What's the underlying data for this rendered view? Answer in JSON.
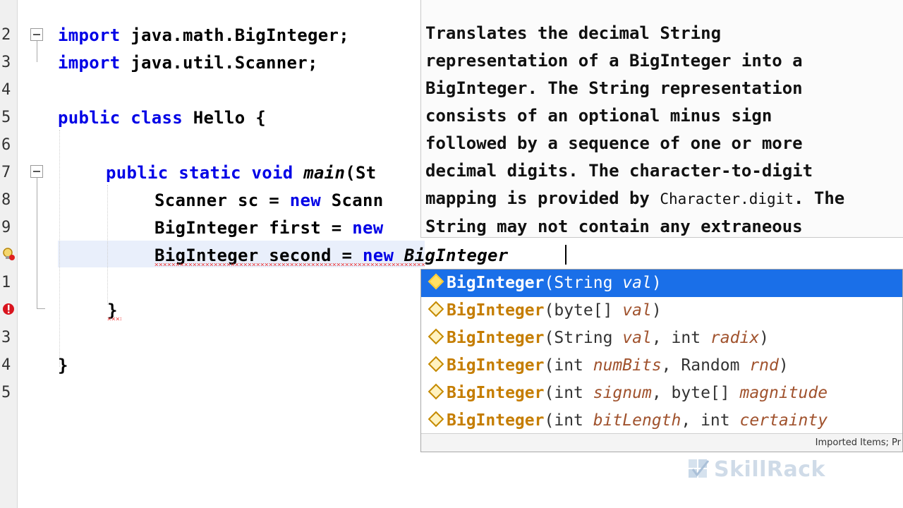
{
  "editor": {
    "line_numbers": [
      "2",
      "3",
      "4",
      "5",
      "6",
      "7",
      "8",
      "9",
      "",
      "1",
      "",
      "3",
      "4",
      "5"
    ],
    "lines": {
      "l2": {
        "kw": "import",
        "rest": " java.math.BigInteger;"
      },
      "l3": {
        "kw": "import",
        "rest": " java.util.Scanner;"
      },
      "l5": {
        "kw1": "public",
        "kw2": " class",
        "rest": " Hello {"
      },
      "l7": {
        "kw1": "public",
        "kw2": " static",
        "kw3": " void",
        "method": " main",
        "rest": "(St"
      },
      "l8": {
        "a": "Scanner sc = ",
        "kw": "new",
        "b": " Scann"
      },
      "l9": {
        "a": "BigInteger first = ",
        "kw": "new"
      },
      "l10": {
        "a": "BigInteger second = ",
        "kw": "new",
        "typed": " BigInteger"
      },
      "l12": {
        "text": "}"
      },
      "l14": {
        "text": "}"
      }
    }
  },
  "javadoc": {
    "line1": "Translates the decimal String",
    "line2": "representation of a BigInteger into a",
    "line3": "BigInteger. The String representation",
    "line4": "consists of an optional minus sign",
    "line5": "followed by a sequence of one or more",
    "line6": "decimal digits. The character-to-digit",
    "line7a": "mapping is provided by ",
    "line7code": "Character.digit",
    "line7b": ". The",
    "line8": "String may not contain any extraneous"
  },
  "completion": {
    "items": [
      {
        "name": "BigInteger",
        "open": "(",
        "t1": "String",
        "p1": " val",
        "close": ")"
      },
      {
        "name": "BigInteger",
        "open": "(",
        "t1": "byte[]",
        "p1": " val",
        "close": ")"
      },
      {
        "name": "BigInteger",
        "open": "(",
        "t1": "String",
        "p1": " val",
        "sep": ", ",
        "t2": "int",
        "p2": " radix",
        "close": ")"
      },
      {
        "name": "BigInteger",
        "open": "(",
        "t1": "int",
        "p1": " numBits",
        "sep": ", ",
        "t2": "Random",
        "p2": " rnd",
        "close": ")"
      },
      {
        "name": "BigInteger",
        "open": "(",
        "t1": "int",
        "p1": " signum",
        "sep": ", ",
        "t2": "byte[]",
        "p2": " magnitude",
        "close": ""
      },
      {
        "name": "BigInteger",
        "open": "(",
        "t1": "int",
        "p1": " bitLength",
        "sep": ", ",
        "t2": "int",
        "p2": " certainty",
        "close": ""
      }
    ],
    "status": "Imported Items; Pr"
  },
  "watermark": {
    "text": "SkillRack"
  }
}
